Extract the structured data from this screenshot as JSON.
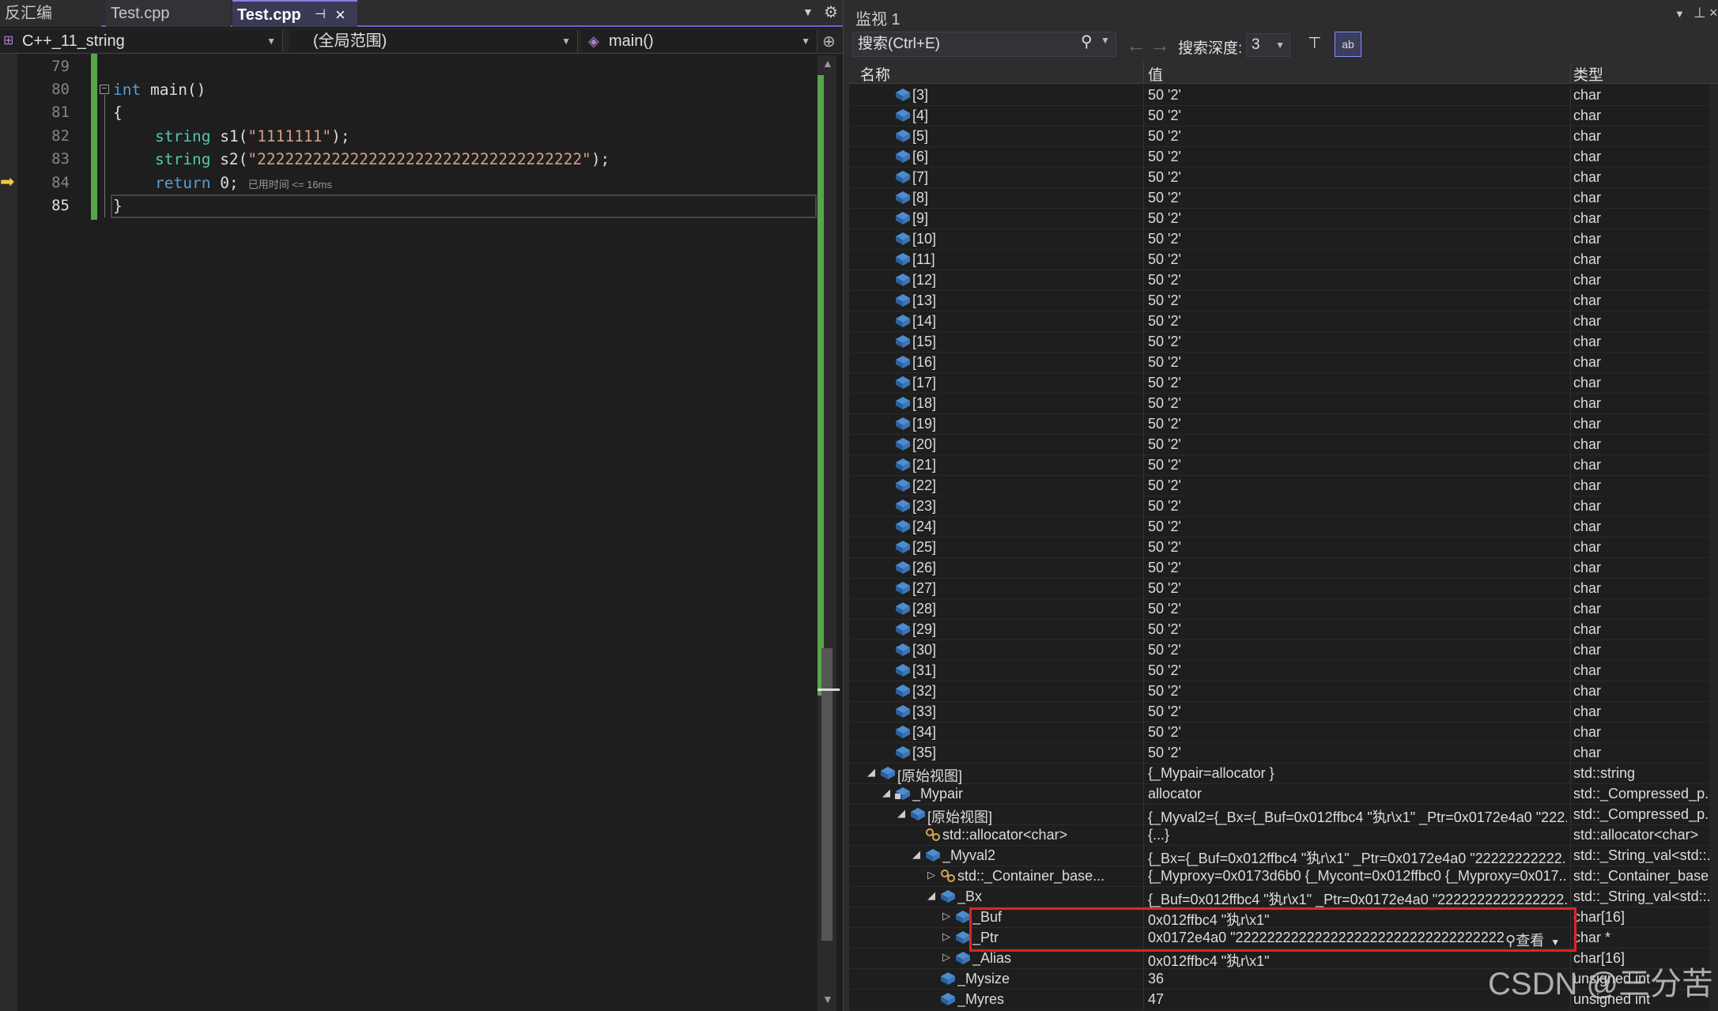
{
  "editor": {
    "tabs": [
      {
        "label": "反汇编"
      },
      {
        "label": "Test.cpp"
      },
      {
        "label": "Test.cpp"
      }
    ],
    "nav": {
      "project": "C++_11_string",
      "scope": "(全局范围)",
      "member": "main()"
    },
    "lines": [
      "79",
      "80",
      "81",
      "82",
      "83",
      "84",
      "85"
    ],
    "code": {
      "l80": {
        "kw": "int",
        "fn": " main()"
      },
      "l81": "{",
      "l82": {
        "ty": "string",
        "id": " s1(",
        "str": "\"1111111\"",
        "end": ");"
      },
      "l83": {
        "ty": "string",
        "id": " s2(",
        "str": "\"22222222222222222222222222222222222\"",
        "end": ");"
      },
      "l84": {
        "kw": "return",
        "end": " 0;",
        "hint": "已用时间 <= 16ms"
      },
      "l85": "}"
    }
  },
  "watch": {
    "title": "监视 1",
    "search_placeholder": "搜索(Ctrl+E)",
    "depth_label": "搜索深度:",
    "depth_value": "3",
    "columns": {
      "name": "名称",
      "value": "值",
      "type": "类型"
    },
    "rows": [
      {
        "level": 2,
        "name": "[3]",
        "value": "50 '2'",
        "type": "char",
        "exp": "",
        "icon": "field"
      },
      {
        "level": 2,
        "name": "[4]",
        "value": "50 '2'",
        "type": "char",
        "exp": "",
        "icon": "field"
      },
      {
        "level": 2,
        "name": "[5]",
        "value": "50 '2'",
        "type": "char",
        "exp": "",
        "icon": "field"
      },
      {
        "level": 2,
        "name": "[6]",
        "value": "50 '2'",
        "type": "char",
        "exp": "",
        "icon": "field"
      },
      {
        "level": 2,
        "name": "[7]",
        "value": "50 '2'",
        "type": "char",
        "exp": "",
        "icon": "field"
      },
      {
        "level": 2,
        "name": "[8]",
        "value": "50 '2'",
        "type": "char",
        "exp": "",
        "icon": "field"
      },
      {
        "level": 2,
        "name": "[9]",
        "value": "50 '2'",
        "type": "char",
        "exp": "",
        "icon": "field"
      },
      {
        "level": 2,
        "name": "[10]",
        "value": "50 '2'",
        "type": "char",
        "exp": "",
        "icon": "field"
      },
      {
        "level": 2,
        "name": "[11]",
        "value": "50 '2'",
        "type": "char",
        "exp": "",
        "icon": "field"
      },
      {
        "level": 2,
        "name": "[12]",
        "value": "50 '2'",
        "type": "char",
        "exp": "",
        "icon": "field"
      },
      {
        "level": 2,
        "name": "[13]",
        "value": "50 '2'",
        "type": "char",
        "exp": "",
        "icon": "field"
      },
      {
        "level": 2,
        "name": "[14]",
        "value": "50 '2'",
        "type": "char",
        "exp": "",
        "icon": "field"
      },
      {
        "level": 2,
        "name": "[15]",
        "value": "50 '2'",
        "type": "char",
        "exp": "",
        "icon": "field"
      },
      {
        "level": 2,
        "name": "[16]",
        "value": "50 '2'",
        "type": "char",
        "exp": "",
        "icon": "field"
      },
      {
        "level": 2,
        "name": "[17]",
        "value": "50 '2'",
        "type": "char",
        "exp": "",
        "icon": "field"
      },
      {
        "level": 2,
        "name": "[18]",
        "value": "50 '2'",
        "type": "char",
        "exp": "",
        "icon": "field"
      },
      {
        "level": 2,
        "name": "[19]",
        "value": "50 '2'",
        "type": "char",
        "exp": "",
        "icon": "field"
      },
      {
        "level": 2,
        "name": "[20]",
        "value": "50 '2'",
        "type": "char",
        "exp": "",
        "icon": "field"
      },
      {
        "level": 2,
        "name": "[21]",
        "value": "50 '2'",
        "type": "char",
        "exp": "",
        "icon": "field"
      },
      {
        "level": 2,
        "name": "[22]",
        "value": "50 '2'",
        "type": "char",
        "exp": "",
        "icon": "field"
      },
      {
        "level": 2,
        "name": "[23]",
        "value": "50 '2'",
        "type": "char",
        "exp": "",
        "icon": "field"
      },
      {
        "level": 2,
        "name": "[24]",
        "value": "50 '2'",
        "type": "char",
        "exp": "",
        "icon": "field"
      },
      {
        "level": 2,
        "name": "[25]",
        "value": "50 '2'",
        "type": "char",
        "exp": "",
        "icon": "field"
      },
      {
        "level": 2,
        "name": "[26]",
        "value": "50 '2'",
        "type": "char",
        "exp": "",
        "icon": "field"
      },
      {
        "level": 2,
        "name": "[27]",
        "value": "50 '2'",
        "type": "char",
        "exp": "",
        "icon": "field"
      },
      {
        "level": 2,
        "name": "[28]",
        "value": "50 '2'",
        "type": "char",
        "exp": "",
        "icon": "field"
      },
      {
        "level": 2,
        "name": "[29]",
        "value": "50 '2'",
        "type": "char",
        "exp": "",
        "icon": "field"
      },
      {
        "level": 2,
        "name": "[30]",
        "value": "50 '2'",
        "type": "char",
        "exp": "",
        "icon": "field"
      },
      {
        "level": 2,
        "name": "[31]",
        "value": "50 '2'",
        "type": "char",
        "exp": "",
        "icon": "field"
      },
      {
        "level": 2,
        "name": "[32]",
        "value": "50 '2'",
        "type": "char",
        "exp": "",
        "icon": "field"
      },
      {
        "level": 2,
        "name": "[33]",
        "value": "50 '2'",
        "type": "char",
        "exp": "",
        "icon": "field"
      },
      {
        "level": 2,
        "name": "[34]",
        "value": "50 '2'",
        "type": "char",
        "exp": "",
        "icon": "field"
      },
      {
        "level": 2,
        "name": "[35]",
        "value": "50 '2'",
        "type": "char",
        "exp": "",
        "icon": "field"
      },
      {
        "level": 1,
        "name": "[原始视图]",
        "value": "{_Mypair=allocator }",
        "type": "std::string",
        "exp": "◢",
        "icon": "field"
      },
      {
        "level": 2,
        "name": "_Mypair",
        "value": "allocator",
        "type": "std::_Compressed_p...",
        "exp": "◢",
        "icon": "locked"
      },
      {
        "level": 3,
        "name": "[原始视图]",
        "value": "{_Myval2={_Bx={_Buf=0x012ffbc4 \"犱r\\x1\" _Ptr=0x0172e4a0 \"222...",
        "type": "std::_Compressed_p...",
        "exp": "◢",
        "icon": "field"
      },
      {
        "level": 4,
        "name": "std::allocator<char>",
        "value": "{...}",
        "type": "std::allocator<char>",
        "exp": "",
        "icon": "base"
      },
      {
        "level": 4,
        "name": "_Myval2",
        "value": "{_Bx={_Buf=0x012ffbc4 \"犱r\\x1\" _Ptr=0x0172e4a0 \"22222222222...",
        "type": "std::_String_val<std::...",
        "exp": "◢",
        "icon": "field"
      },
      {
        "level": 5,
        "name": "std::_Container_base...",
        "value": "{_Myproxy=0x0173d6b0 {_Mycont=0x012ffbc0 {_Myproxy=0x017...",
        "type": "std::_Container_base...",
        "exp": "▷",
        "icon": "base"
      },
      {
        "level": 5,
        "name": "_Bx",
        "value": "{_Buf=0x012ffbc4 \"犱r\\x1\" _Ptr=0x0172e4a0 \"2222222222222222...",
        "type": "std::_String_val<std::...",
        "exp": "◢",
        "icon": "field"
      },
      {
        "level": 6,
        "name": "_Buf",
        "value": "0x012ffbc4 \"犱r\\x1\"",
        "type": "char[16]",
        "exp": "▷",
        "icon": "field"
      },
      {
        "level": 6,
        "name": "_Ptr",
        "value": "0x0172e4a0 \"22222222222222222222222222222222222...",
        "type": "char *",
        "exp": "▷",
        "icon": "field",
        "view": "查看"
      },
      {
        "level": 6,
        "name": "_Alias",
        "value": "0x012ffbc4 \"犱r\\x1\"",
        "type": "char[16]",
        "exp": "▷",
        "icon": "field"
      },
      {
        "level": 5,
        "name": "_Mysize",
        "value": "36",
        "type": "unsigned int",
        "exp": "",
        "icon": "field"
      },
      {
        "level": 5,
        "name": "_Myres",
        "value": "47",
        "type": "unsigned int",
        "exp": "",
        "icon": "field"
      }
    ]
  },
  "watermark": "CSDN @三分苦",
  "colors": {
    "accent": "#6e5fcf",
    "highlight_box": "#e02424",
    "change_bar": "#57a64a"
  }
}
